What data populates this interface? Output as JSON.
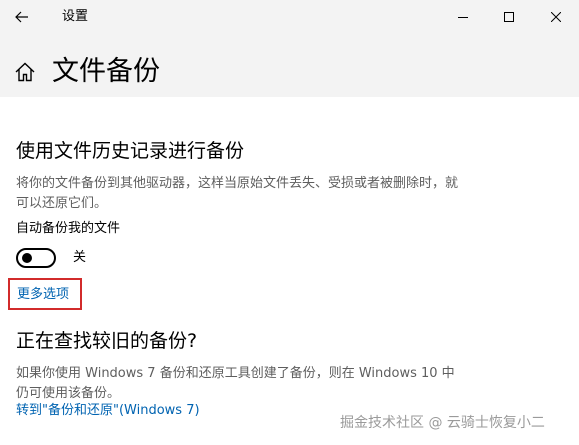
{
  "window": {
    "title": "设置"
  },
  "header": {
    "page_title": "文件备份"
  },
  "file_history": {
    "heading": "使用文件历史记录进行备份",
    "description": "将你的文件备份到其他驱动器，这样当原始文件丢失、受损或者被删除时，就可以还原它们。",
    "toggle_label": "自动备份我的文件",
    "toggle_on": false,
    "toggle_state_text": "关",
    "more_options_label": "更多选项"
  },
  "older_backup": {
    "heading": "正在查找较旧的备份?",
    "description": "如果你使用 Windows 7 备份和还原工具创建了备份，则在 Windows 10 中仍可使用该备份。",
    "link_label": "转到\"备份和还原\"(Windows 7)"
  },
  "watermark": "掘金技术社区 @ 云骑士恢复小二",
  "colors": {
    "link": "#0063b1",
    "highlight_border": "#d22b2b",
    "header_background": "#f3f3f3",
    "secondary_text": "#5e5e5e"
  },
  "icons": {
    "back": "back-arrow-icon",
    "home": "home-icon",
    "minimize": "minimize-icon",
    "maximize": "maximize-icon",
    "close": "close-icon"
  }
}
